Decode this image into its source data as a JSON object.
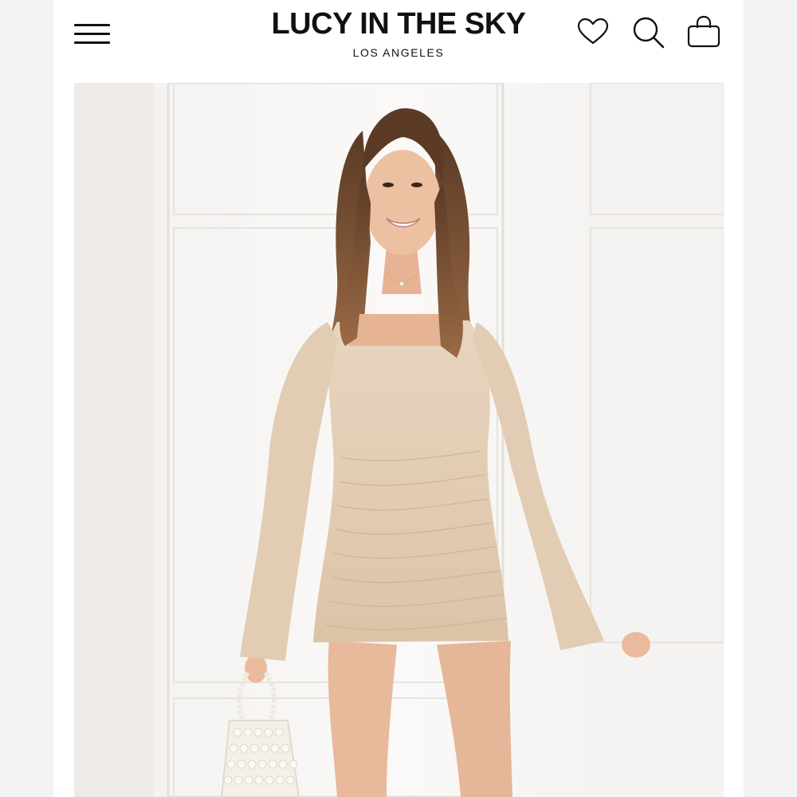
{
  "header": {
    "brand": "LUCY IN THE SKY",
    "location": "LOS ANGELES",
    "icons": {
      "menu": "hamburger-menu-icon",
      "wishlist": "heart-icon",
      "search": "search-icon",
      "bag": "shopping-bag-icon"
    }
  },
  "hero": {
    "product_image": "model-in-beige-ruched-bell-sleeve-mini-dress",
    "dress_color": "#e4cdb4",
    "background_color": "#f7f5f3"
  }
}
